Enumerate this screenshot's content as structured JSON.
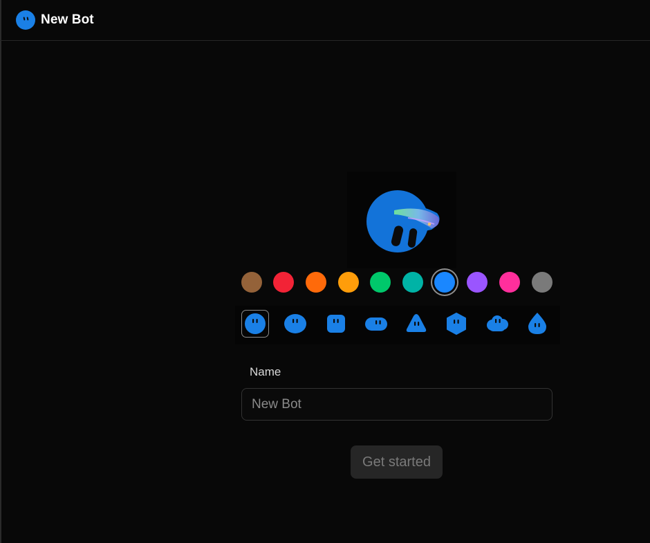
{
  "header": {
    "title": "New Bot",
    "avatar_icon": "bot-avatar-icon"
  },
  "theme": {
    "accent": "#1a80e6",
    "hero_fill": "#1373d9"
  },
  "colors": [
    {
      "name": "brown",
      "hex": "#946239",
      "selected": false
    },
    {
      "name": "red",
      "hex": "#f22336",
      "selected": false
    },
    {
      "name": "orange",
      "hex": "#ff6a0a",
      "selected": false
    },
    {
      "name": "amber",
      "hex": "#ff9d0a",
      "selected": false
    },
    {
      "name": "green",
      "hex": "#00c86b",
      "selected": false
    },
    {
      "name": "teal",
      "hex": "#00b3a6",
      "selected": false
    },
    {
      "name": "blue",
      "hex": "#1a87ff",
      "selected": true
    },
    {
      "name": "purple",
      "hex": "#9a55ff",
      "selected": false
    },
    {
      "name": "pink",
      "hex": "#ff2f9c",
      "selected": false
    },
    {
      "name": "gray",
      "hex": "#7a7a7a",
      "selected": false
    }
  ],
  "shapes": [
    {
      "name": "circle",
      "selected": true
    },
    {
      "name": "oval",
      "selected": false
    },
    {
      "name": "square",
      "selected": false
    },
    {
      "name": "pill",
      "selected": false
    },
    {
      "name": "triangle",
      "selected": false
    },
    {
      "name": "hexagon",
      "selected": false
    },
    {
      "name": "cloud",
      "selected": false
    },
    {
      "name": "drop",
      "selected": false
    }
  ],
  "form": {
    "name_label": "Name",
    "name_value": "",
    "name_placeholder": "New Bot",
    "submit_label": "Get started"
  }
}
